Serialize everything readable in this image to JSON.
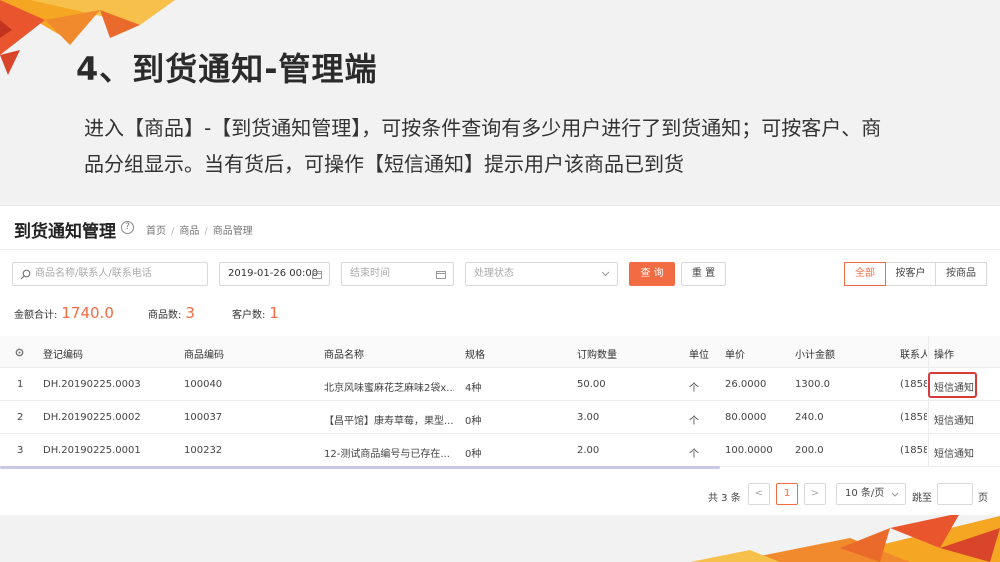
{
  "slide": {
    "title": "4、到货通知-管理端",
    "description": "进入【商品】-【到货通知管理】，可按条件查询有多少用户进行了到货通知；可按客户、商品分组显示。当有货后，可操作【短信通知】提示用户该商品已到货"
  },
  "page": {
    "title": "到货通知管理",
    "help_icon": "?",
    "breadcrumb": [
      "首页",
      "商品",
      "商品管理"
    ],
    "breadcrumb_sep": "/"
  },
  "filters": {
    "search_placeholder": "商品名称/联系人/联系电话",
    "start_date": "2019-01-26 00:00",
    "end_placeholder": "结束时间",
    "status_placeholder": "处理状态",
    "query_label": "查 询",
    "reset_label": "重 置"
  },
  "group_toggle": [
    "全部",
    "按客户",
    "按商品"
  ],
  "summary": {
    "amount_label": "金额合计:",
    "amount_value": "1740.0",
    "product_label": "商品数:",
    "product_value": "3",
    "customer_label": "客户数:",
    "customer_value": "1"
  },
  "table": {
    "headers": [
      "登记编码",
      "商品编码",
      "商品名称",
      "规格",
      "订购数量",
      "单位",
      "单价",
      "小计金额",
      "联系人",
      "操作"
    ],
    "rows": [
      {
        "index": "1",
        "reg_code": "DH.20190225.0003",
        "product_code": "100040",
        "name": "北京风味蜜麻花芝麻味2袋x...",
        "spec": "4种",
        "qty": "50.00",
        "unit": "个",
        "price": "26.0000",
        "subtotal": "1300.0",
        "contact": "(1858",
        "action": "短信通知"
      },
      {
        "index": "2",
        "reg_code": "DH.20190225.0002",
        "product_code": "100037",
        "name": "【昌平馆】康寿草莓，果型...",
        "spec": "0种",
        "qty": "3.00",
        "unit": "个",
        "price": "80.0000",
        "subtotal": "240.0",
        "contact": "(1858",
        "action": "短信通知"
      },
      {
        "index": "3",
        "reg_code": "DH.20190225.0001",
        "product_code": "100232",
        "name": "12-测试商品编号与已存在...",
        "spec": "0种",
        "qty": "2.00",
        "unit": "个",
        "price": "100.0000",
        "subtotal": "200.0",
        "contact": "(1858",
        "action": "短信通知"
      }
    ]
  },
  "pagination": {
    "total": "共 3 条",
    "prev": "<",
    "current_page": "1",
    "next": ">",
    "page_size": "10 条/页",
    "goto_label": "跳至",
    "page_suffix": "页"
  },
  "colors": {
    "accent": "#f36b43",
    "link": "#3f7fd6",
    "highlight": "#d83a3a"
  }
}
